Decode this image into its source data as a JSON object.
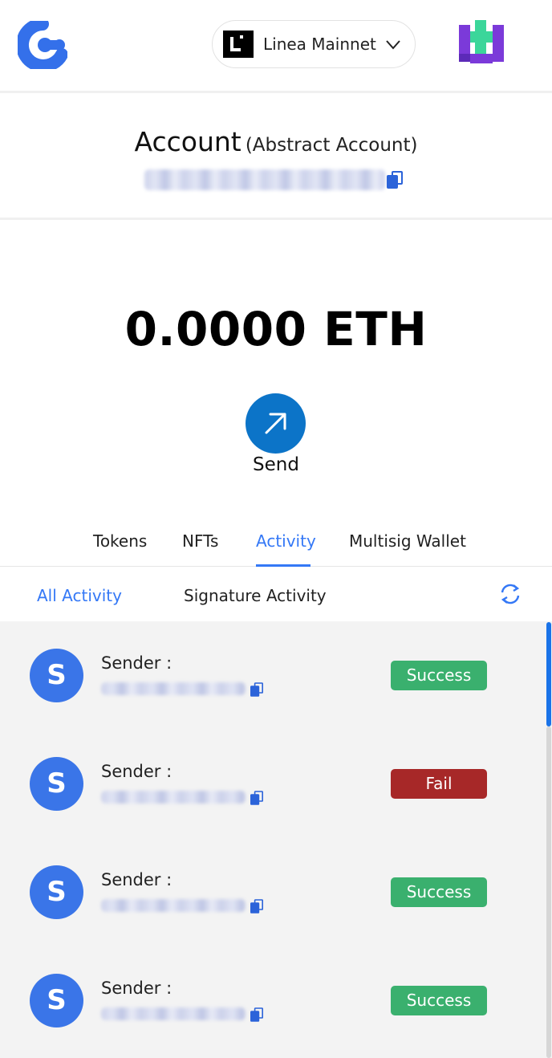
{
  "header": {
    "network_name": "Linea Mainnet",
    "logo_icon": "app-logo-icon",
    "network_icon": "linea-icon",
    "dropdown_icon": "chevron-down-icon",
    "avatar_icon": "account-avatar-icon"
  },
  "account": {
    "title": "Account",
    "subtitle": "(Abstract Account)"
  },
  "balance": {
    "amount": "0.0000 ETH"
  },
  "send": {
    "label": "Send",
    "icon": "arrow-up-right-icon"
  },
  "tabs": [
    {
      "label": "Tokens",
      "active": false
    },
    {
      "label": "NFTs",
      "active": false
    },
    {
      "label": "Activity",
      "active": true
    },
    {
      "label": "Multisig Wallet",
      "active": false
    }
  ],
  "subtabs": [
    {
      "label": "All Activity",
      "active": true
    },
    {
      "label": "Signature Activity",
      "active": false
    }
  ],
  "activity": [
    {
      "avatar_letter": "S",
      "sender_label": "Sender :",
      "status": "Success"
    },
    {
      "avatar_letter": "S",
      "sender_label": "Sender :",
      "status": "Fail"
    },
    {
      "avatar_letter": "S",
      "sender_label": "Sender :",
      "status": "Success"
    },
    {
      "avatar_letter": "S",
      "sender_label": "Sender :",
      "status": "Success"
    }
  ],
  "colors": {
    "accent": "#3478f6",
    "send_button": "#0c74c8",
    "success": "#3ab06e",
    "fail": "#a72828",
    "avatar": "#3a75e8"
  }
}
